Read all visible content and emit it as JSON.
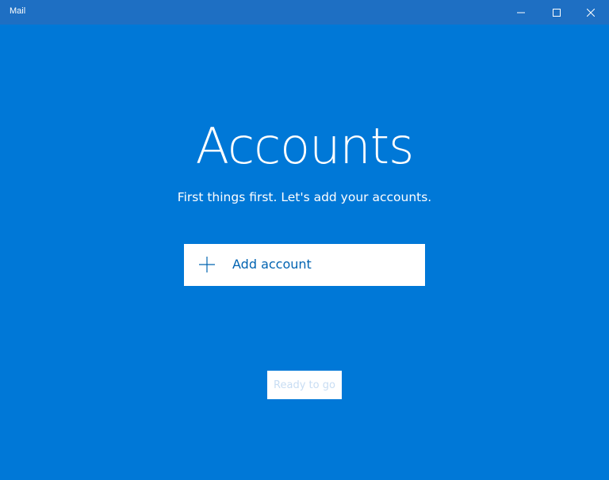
{
  "window": {
    "title": "Mail",
    "controls": {
      "minimize_icon": "minimize-icon",
      "maximize_icon": "maximize-icon",
      "close_icon": "close-icon"
    }
  },
  "colors": {
    "background": "#0078d7",
    "titlebar": "#1e6fc3",
    "accent_text": "#0063b1",
    "disabled_text": "#c8ddf3"
  },
  "main": {
    "heading": "Accounts",
    "subheading": "First things first. Let's add your accounts.",
    "add_account": {
      "icon": "plus-icon",
      "label": "Add account"
    },
    "ready_button": {
      "label": "Ready to go",
      "state": "disabled"
    }
  }
}
